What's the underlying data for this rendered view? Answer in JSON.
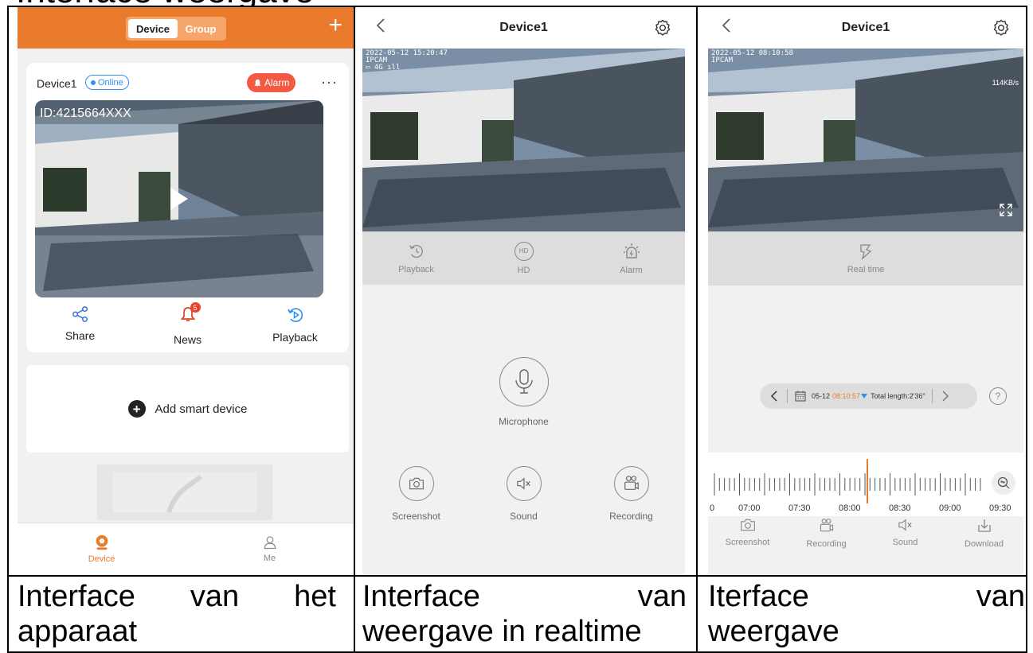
{
  "cut_heading": "Interface weergave",
  "panel_device": {
    "segment": {
      "device": "Device",
      "group": "Group"
    },
    "add_glyph": "+",
    "device_name": "Device1",
    "status": "Online",
    "alarm_label": "Alarm",
    "more": "···",
    "device_id": "ID:4215664XXX",
    "news_badge": "5",
    "actions": {
      "share": "Share",
      "news": "News",
      "playback": "Playback"
    },
    "add_device": "Add smart device",
    "tabs": {
      "device": "Device",
      "me": "Me"
    }
  },
  "panel_realtime": {
    "title": "Device1",
    "osd_time": "2022-05-12 15:20:47",
    "osd_cam": "IPCAM",
    "osd_signal": "4G",
    "tools": {
      "playback": "Playback",
      "hd": "HD",
      "alarm": "Alarm"
    },
    "hd_glyph": "HD",
    "microphone": "Microphone",
    "actions": {
      "screenshot": "Screenshot",
      "sound": "Sound",
      "recording": "Recording"
    }
  },
  "panel_playback": {
    "title": "Device1",
    "osd_time": "2022-05-12 08:10:58",
    "osd_cam": "IPCAM",
    "speed": "114KB/s",
    "real_time": "Real time",
    "date": "05-12",
    "time": "08:10:57",
    "total": "Total length:2'36\"",
    "help_glyph": "?",
    "timeline_labels": [
      "0",
      "07:00",
      "07:30",
      "08:00",
      "08:30",
      "09:00",
      "09:30"
    ],
    "actions": {
      "screenshot": "Screenshot",
      "recording": "Recording",
      "sound": "Sound",
      "download": "Download"
    }
  },
  "captions": {
    "c1_words": [
      "Interface",
      "van",
      "het"
    ],
    "c1_line2": "apparaat",
    "c2_words": [
      "Interface",
      "van"
    ],
    "c2_line2": "weergave in realtime",
    "c3_words": [
      "Iterface",
      "van"
    ],
    "c3_line2": "weergave"
  },
  "colors": {
    "brand_orange": "#ea7a2c",
    "online_blue": "#2f8ef3",
    "alarm_red": "#f25a44"
  }
}
